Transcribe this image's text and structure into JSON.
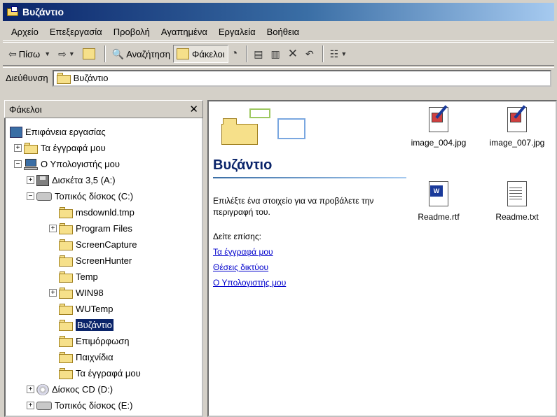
{
  "window": {
    "title": "Βυζάντιο"
  },
  "menu": [
    "Αρχείο",
    "Επεξεργασία",
    "Προβολή",
    "Αγαπημένα",
    "Εργαλεία",
    "Βοήθεια"
  ],
  "toolbar": {
    "back_label": "Πίσω",
    "search_label": "Αναζήτηση",
    "folders_label": "Φάκελοι"
  },
  "address": {
    "label": "Διεύθυνση",
    "value": "Βυζάντιο"
  },
  "folders_pane": {
    "title": "Φάκελοι",
    "tree": [
      {
        "label": "Επιφάνεια εργασίας"
      },
      {
        "label": "Τα έγγραφά μου"
      },
      {
        "label": "Ο Υπολογιστής μου"
      },
      {
        "label": "Δισκέτα 3,5 (A:)"
      },
      {
        "label": "Τοπικός δίσκος (C:)"
      },
      {
        "label": "msdownld.tmp"
      },
      {
        "label": "Program Files"
      },
      {
        "label": "ScreenCapture"
      },
      {
        "label": "ScreenHunter"
      },
      {
        "label": "Temp"
      },
      {
        "label": "WIN98"
      },
      {
        "label": "WUTemp"
      },
      {
        "label": "Βυζάντιο"
      },
      {
        "label": "Επιμόρφωση"
      },
      {
        "label": "Παιχνίδια"
      },
      {
        "label": "Τα έγγραφά μου"
      },
      {
        "label": "Δίσκος CD (D:)"
      },
      {
        "label": "Τοπικός δίσκος (E:)"
      }
    ]
  },
  "info": {
    "title": "Βυζάντιο",
    "description": "Επιλέξτε ένα στοιχείο για να προβάλετε την περιγραφή του.",
    "see_also": "Δείτε επίσης:",
    "links": [
      "Τα έγγραφά μου",
      "Θέσεις δικτύου",
      "Ο Υπολογιστής μου"
    ]
  },
  "files": [
    {
      "name": "image_004.jpg",
      "icon": "jpg-file-icon"
    },
    {
      "name": "image_007.jpg",
      "icon": "jpg-file-icon"
    },
    {
      "name": "Readme.rtf",
      "icon": "rtf-file-icon"
    },
    {
      "name": "Readme.txt",
      "icon": "txt-file-icon"
    }
  ]
}
